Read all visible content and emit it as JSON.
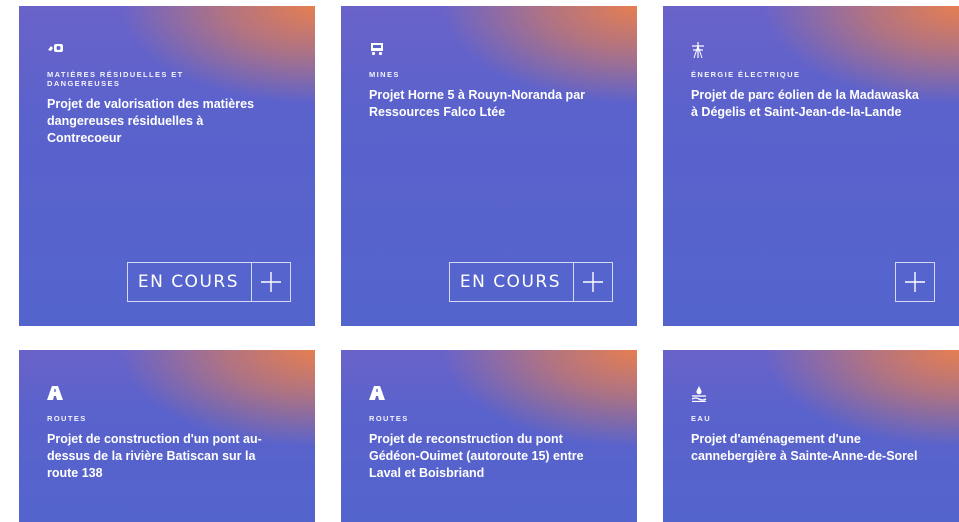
{
  "cards": [
    {
      "icon": "hazard-waste-icon",
      "category": "Matières résiduelles et dangereuses",
      "title": "Projet de valorisation des matières dangereuses résiduelles à Contrecoeur",
      "status": "EN COURS",
      "expand_icon": "plus-icon"
    },
    {
      "icon": "mine-cart-icon",
      "category": "Mines",
      "title": "Projet Horne 5 à Rouyn-Noranda par Ressources Falco Ltée",
      "status": "EN COURS",
      "expand_icon": "plus-icon"
    },
    {
      "icon": "power-pylon-icon",
      "category": "Énergie électrique",
      "title": "Projet de parc éolien de la Madawaska à Dégelis et Saint-Jean-de-la-Lande",
      "status": "",
      "expand_icon": "plus-icon"
    },
    {
      "icon": "road-icon",
      "category": "Routes",
      "title": "Projet de construction d'un pont au-dessus de la rivière Batiscan sur la route 138"
    },
    {
      "icon": "road-icon",
      "category": "Routes",
      "title": "Projet de reconstruction du pont Gédéon-Ouimet (autoroute 15) entre Laval et Boisbriand"
    },
    {
      "icon": "water-icon",
      "category": "Eau",
      "title": "Projet d'aménagement d'une cannebergière à Sainte-Anne-de-Sorel"
    }
  ],
  "colors": {
    "card_blue": "#5464cd",
    "card_orange": "#ec804a",
    "text": "#ffffff"
  }
}
